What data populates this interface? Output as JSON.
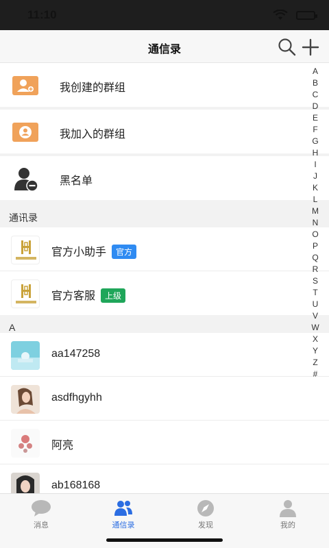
{
  "status": {
    "time": "11:10"
  },
  "nav": {
    "title": "通信录",
    "search_icon": "search-icon",
    "add_icon": "plus-icon"
  },
  "groups": [
    {
      "label": "我创建的群组",
      "icon": "group-add-icon"
    },
    {
      "label": "我加入的群组",
      "icon": "group-chat-icon"
    },
    {
      "label": "黑名单",
      "icon": "blacklist-icon"
    }
  ],
  "sections": {
    "contacts_header": "通讯录",
    "a_header": "A"
  },
  "official": [
    {
      "name": "官方小助手",
      "badge": "官方",
      "badge_color": "#2f8bf2"
    },
    {
      "name": "官方客服",
      "badge": "上级",
      "badge_color": "#1fa65a"
    }
  ],
  "contacts_a": [
    {
      "name": "aa147258"
    },
    {
      "name": "asdfhgyhh"
    },
    {
      "name": "阿亮"
    },
    {
      "name": "ab168168"
    }
  ],
  "index_letters": [
    "A",
    "B",
    "C",
    "D",
    "E",
    "F",
    "G",
    "H",
    "I",
    "J",
    "K",
    "L",
    "M",
    "N",
    "O",
    "P",
    "Q",
    "R",
    "S",
    "T",
    "U",
    "V",
    "W",
    "X",
    "Y",
    "Z",
    "#"
  ],
  "tabs": [
    {
      "label": "消息",
      "icon": "chat-bubble-icon"
    },
    {
      "label": "通信录",
      "icon": "contacts-icon"
    },
    {
      "label": "发现",
      "icon": "compass-icon"
    },
    {
      "label": "我的",
      "icon": "profile-icon"
    }
  ],
  "colors": {
    "accent": "#2b6de2",
    "group_icon_orange": "#f0a25a",
    "tab_inactive": "#b8b8b8"
  }
}
